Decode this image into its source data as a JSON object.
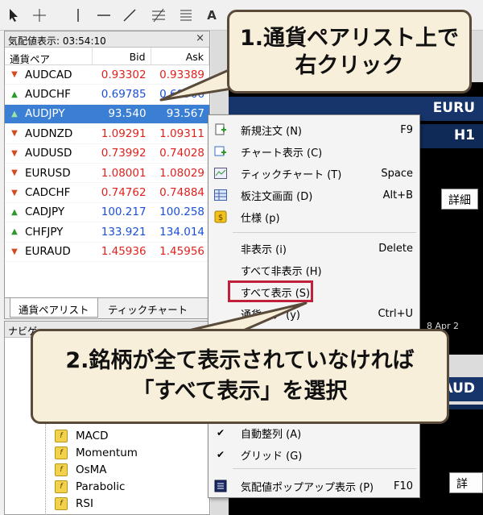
{
  "toolbar": {
    "icons": [
      "cursor-icon",
      "crosshair-icon",
      "vertical-line-icon",
      "horizontal-line-icon",
      "trendline-icon",
      "fibonacci-icon",
      "channel-icon",
      "text-tool-icon"
    ],
    "text_tool": "A"
  },
  "market_watch": {
    "title": "気配値表示: 03:54:10",
    "close": "×",
    "columns": {
      "symbol": "通貨ペア",
      "bid": "Bid",
      "ask": "Ask"
    },
    "rows": [
      {
        "symbol": "AUDCAD",
        "bid": "0.93302",
        "ask": "0.93389",
        "dir": "down",
        "color": "red"
      },
      {
        "symbol": "AUDCHF",
        "bid": "0.69785",
        "ask": "0.69906",
        "dir": "up",
        "color": "blue"
      },
      {
        "symbol": "AUDJPY",
        "bid": "93.540",
        "ask": "93.567",
        "dir": "up",
        "color": "sel"
      },
      {
        "symbol": "AUDNZD",
        "bid": "1.09291",
        "ask": "1.09311",
        "dir": "down",
        "color": "red"
      },
      {
        "symbol": "AUDUSD",
        "bid": "0.73992",
        "ask": "0.74028",
        "dir": "down",
        "color": "red"
      },
      {
        "symbol": "EURUSD",
        "bid": "1.08001",
        "ask": "1.08029",
        "dir": "down",
        "color": "red"
      },
      {
        "symbol": "CADCHF",
        "bid": "0.74762",
        "ask": "0.74884",
        "dir": "down",
        "color": "red"
      },
      {
        "symbol": "CADJPY",
        "bid": "100.217",
        "ask": "100.258",
        "dir": "up",
        "color": "blue"
      },
      {
        "symbol": "CHFJPY",
        "bid": "133.921",
        "ask": "134.014",
        "dir": "up",
        "color": "blue"
      },
      {
        "symbol": "EURAUD",
        "bid": "1.45936",
        "ask": "1.45956",
        "dir": "down",
        "color": "red"
      }
    ],
    "tabs": [
      "通貨ペアリスト",
      "ティックチャート"
    ]
  },
  "navigator": {
    "title": "ナビゲ",
    "items": [
      "MACD",
      "Momentum",
      "OsMA",
      "Parabolic",
      "RSI"
    ]
  },
  "charts": {
    "bar1": "EURU",
    "bar1b": "H1",
    "bar2": "AUD",
    "bar2b": "H",
    "detail1": "詳細",
    "detail2": "詳細",
    "date": "8 Apr 2"
  },
  "context_menu": {
    "items": [
      {
        "label": "新規注文 (N)",
        "shortcut": "F9",
        "icon": "new-order-icon"
      },
      {
        "label": "チャート表示 (C)",
        "shortcut": "",
        "icon": "chart-window-icon"
      },
      {
        "label": "ティックチャート (T)",
        "shortcut": "Space",
        "icon": "tick-chart-icon"
      },
      {
        "label": "板注文画面 (D)",
        "shortcut": "Alt+B",
        "icon": "depth-of-market-icon"
      },
      {
        "label": "仕様 (p)",
        "shortcut": "",
        "icon": "specification-icon"
      },
      {
        "label": "非表示 (i)",
        "shortcut": "Delete",
        "icon": ""
      },
      {
        "label": "すべて非表示 (H)",
        "shortcut": "",
        "icon": ""
      },
      {
        "label": "すべて表示 (S)",
        "shortcut": "",
        "icon": ""
      },
      {
        "label": "通貨ペア (y)",
        "shortcut": "Ctrl+U",
        "icon": ""
      },
      {
        "label": "自動整列 (A)",
        "shortcut": "",
        "icon": "checkmark-icon"
      },
      {
        "label": "グリッド (G)",
        "shortcut": "",
        "icon": "checkmark-icon"
      },
      {
        "label": "気配値ポップアップ表示 (P)",
        "shortcut": "F10",
        "icon": "popup-prices-icon"
      }
    ]
  },
  "callouts": {
    "step1_line1": "1.通貨ペアリスト上で",
    "step1_line2": "右クリック",
    "step2_line1": "2.銘柄が全て表示されていなければ",
    "step2_line2": "「すべて表示」を選択"
  },
  "colors": {
    "highlight_border": "#c0203a",
    "selection": "#3b7fd4",
    "chart_bar": "#17356a",
    "callout_bg": "#f8efda"
  }
}
